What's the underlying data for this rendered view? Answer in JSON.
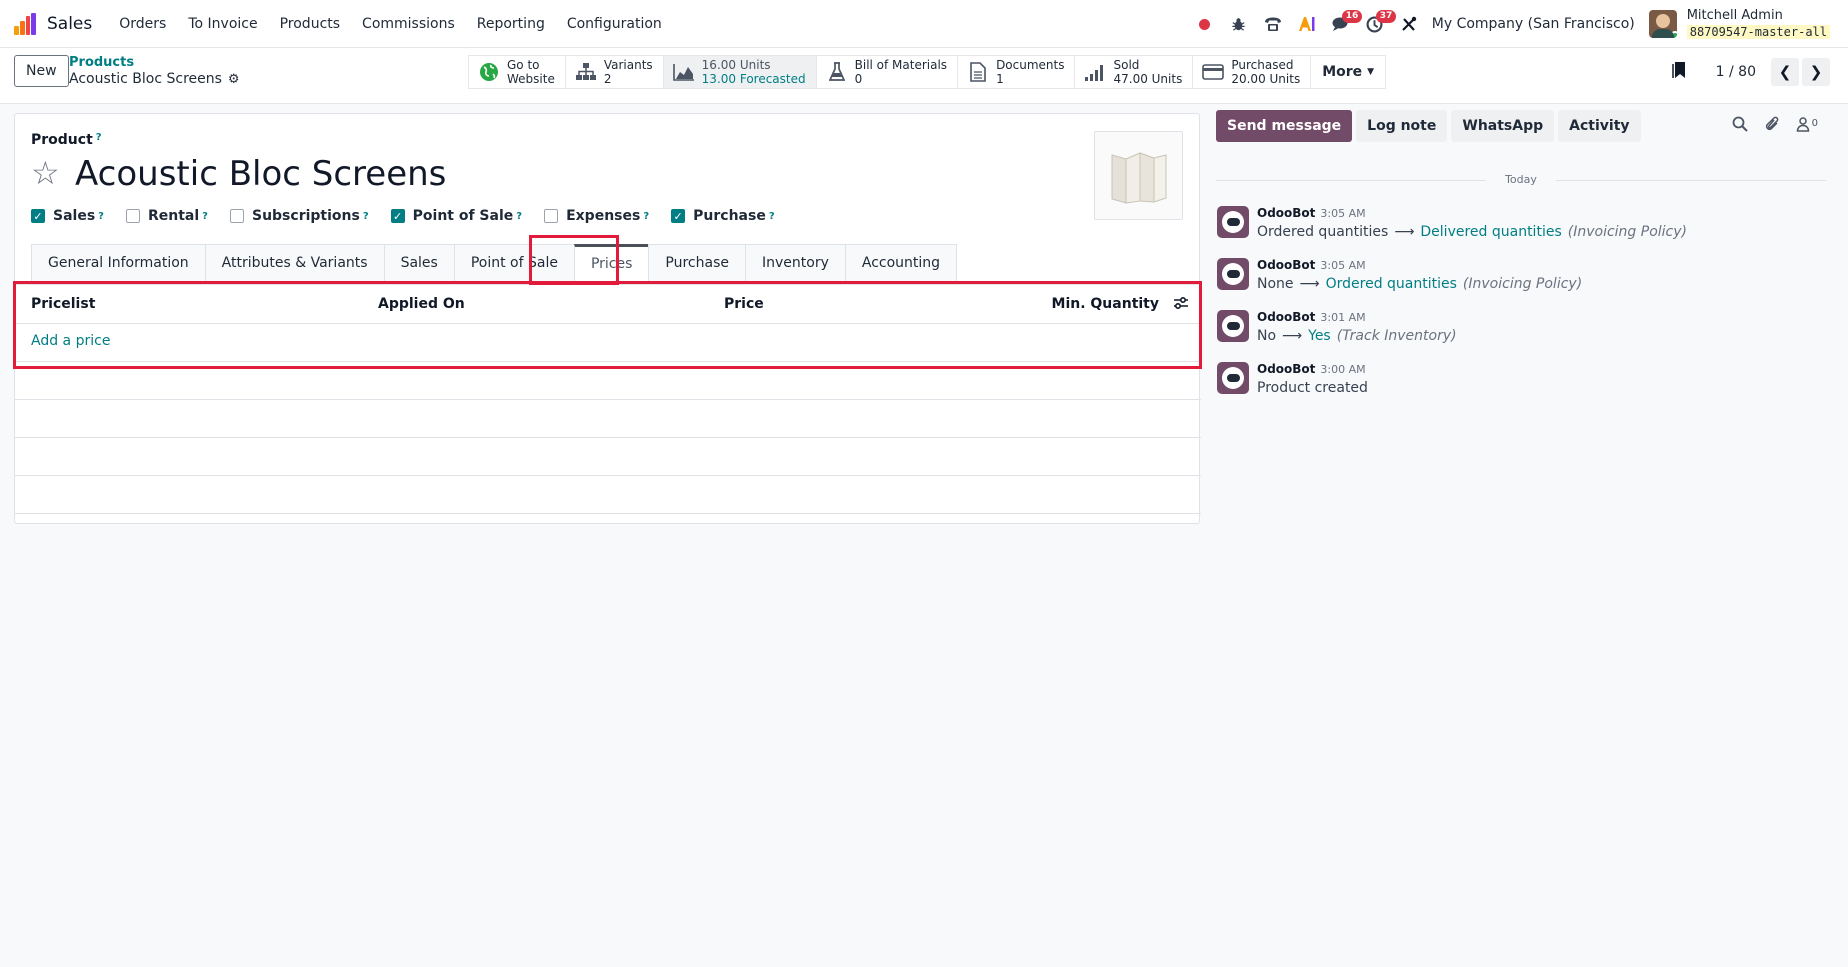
{
  "navbar": {
    "app_name": "Sales",
    "menu": [
      "Orders",
      "To Invoice",
      "Products",
      "Commissions",
      "Reporting",
      "Configuration"
    ],
    "messages_badge": "16",
    "activities_badge": "37",
    "company": "My Company (San Francisco)",
    "user_name": "Mitchell Admin",
    "database": "88709547-master-all"
  },
  "control": {
    "new_label": "New",
    "breadcrumb_parent": "Products",
    "breadcrumb_current": "Acoustic Bloc Screens",
    "smart_buttons": {
      "website": {
        "line1": "Go to",
        "line2": "Website",
        "icon": "globe-icon"
      },
      "variants": {
        "line1": "Variants",
        "line2": "2",
        "icon": "sitemap-icon"
      },
      "stock": {
        "line1": "16.00 Units",
        "line2": "13.00 Forecasted",
        "icon": "area-chart-icon"
      },
      "bom": {
        "line1": "Bill of Materials",
        "line2": "0",
        "icon": "flask-icon"
      },
      "documents": {
        "line1": "Documents",
        "line2": "1",
        "icon": "file-icon"
      },
      "sold": {
        "line1": "Sold",
        "line2": "47.00 Units",
        "icon": "signal-icon"
      },
      "purchased": {
        "line1": "Purchased",
        "line2": "20.00 Units",
        "icon": "credit-card-icon"
      }
    },
    "more_label": "More",
    "pager": "1 / 80"
  },
  "form": {
    "product_label": "Product",
    "help_mark": "?",
    "name": "Acoustic Bloc Screens",
    "checkboxes": [
      {
        "label": "Sales",
        "checked": true
      },
      {
        "label": "Rental",
        "checked": false
      },
      {
        "label": "Subscriptions",
        "checked": false
      },
      {
        "label": "Point of Sale",
        "checked": true
      },
      {
        "label": "Expenses",
        "checked": false
      },
      {
        "label": "Purchase",
        "checked": true
      }
    ],
    "tabs": [
      "General Information",
      "Attributes & Variants",
      "Sales",
      "Point of Sale",
      "Prices",
      "Purchase",
      "Inventory",
      "Accounting"
    ],
    "active_tab": "Prices",
    "table": {
      "columns": [
        "Pricelist",
        "Applied On",
        "Price",
        "Min. Quantity"
      ],
      "add_label": "Add a price"
    }
  },
  "chatter": {
    "buttons": [
      "Send message",
      "Log note",
      "WhatsApp",
      "Activity"
    ],
    "follower_count": "0",
    "date_separator": "Today",
    "messages": [
      {
        "author": "OdooBot",
        "time": "3:05 AM",
        "old": "Ordered quantities",
        "new": "Delivered quantities",
        "field": "(Invoicing Policy)"
      },
      {
        "author": "OdooBot",
        "time": "3:05 AM",
        "old": "None",
        "new": "Ordered quantities",
        "field": "(Invoicing Policy)"
      },
      {
        "author": "OdooBot",
        "time": "3:01 AM",
        "old": "No",
        "new": "Yes",
        "field": "(Track Inventory)"
      },
      {
        "author": "OdooBot",
        "time": "3:00 AM",
        "text": "Product created"
      }
    ]
  },
  "colors": {
    "accent": "#017e84",
    "primary": "#714b67",
    "highlight": "#e31b3b",
    "checkbox_on": "#017e84"
  }
}
